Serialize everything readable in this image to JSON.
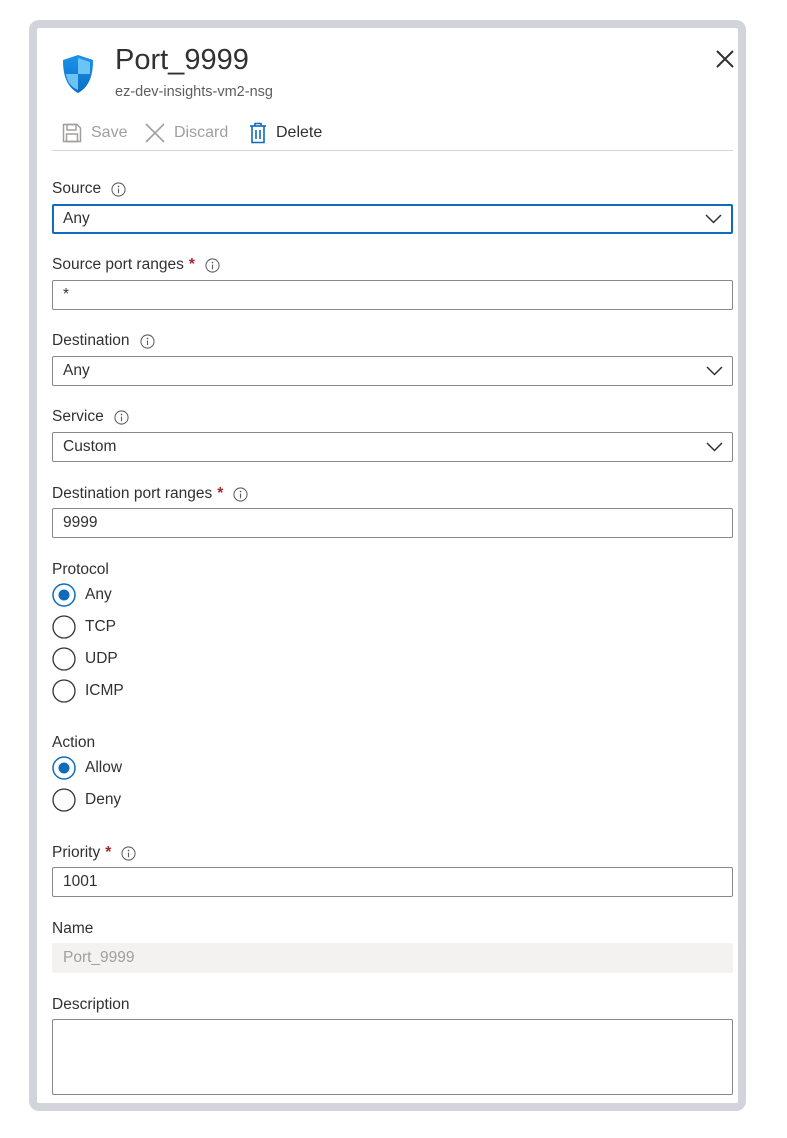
{
  "header": {
    "title": "Port_9999",
    "subtitle": "ez-dev-insights-vm2-nsg",
    "icon": "shield-icon",
    "close_icon": "close-icon"
  },
  "toolbar": {
    "save_label": "Save",
    "discard_label": "Discard",
    "delete_label": "Delete"
  },
  "form": {
    "source": {
      "label": "Source",
      "value": "Any"
    },
    "source_port_ranges": {
      "label": "Source port ranges",
      "required_mark": "*",
      "value": "*"
    },
    "destination": {
      "label": "Destination",
      "value": "Any"
    },
    "service": {
      "label": "Service",
      "value": "Custom"
    },
    "destination_port_ranges": {
      "label": "Destination port ranges",
      "required_mark": "*",
      "value": "9999"
    },
    "protocol": {
      "label": "Protocol",
      "options": [
        "Any",
        "TCP",
        "UDP",
        "ICMP"
      ],
      "selected": "Any"
    },
    "action": {
      "label": "Action",
      "options": [
        "Allow",
        "Deny"
      ],
      "selected": "Allow"
    },
    "priority": {
      "label": "Priority",
      "required_mark": "*",
      "value": "1001"
    },
    "name": {
      "label": "Name",
      "value": "Port_9999"
    },
    "description": {
      "label": "Description",
      "value": ""
    }
  },
  "colors": {
    "accent": "#0f6cbd",
    "required": "#a4262c",
    "frame": "#d2d4dc"
  }
}
